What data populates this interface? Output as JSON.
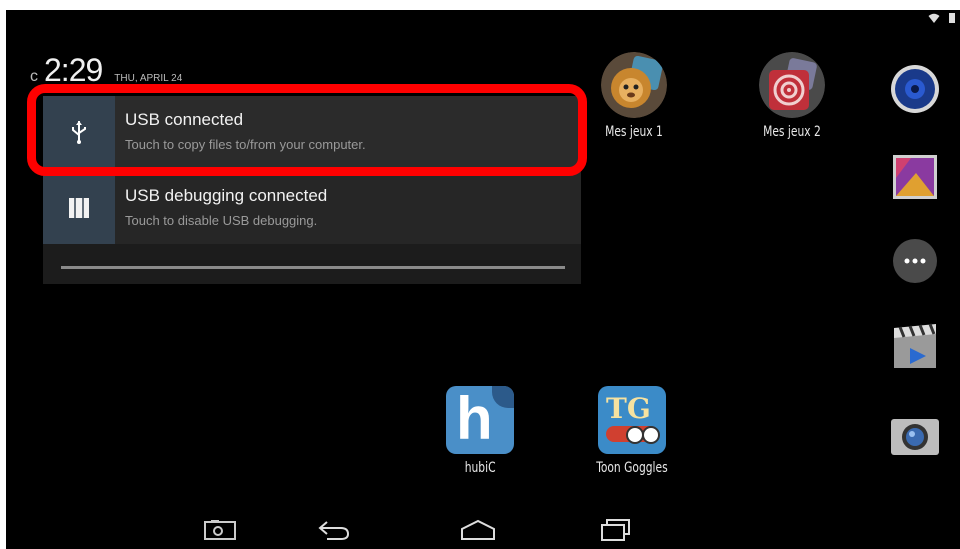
{
  "clock": {
    "prefix": "c",
    "time": "2:29",
    "date": "THU, APRIL 24"
  },
  "notifications": [
    {
      "title": "USB connected",
      "subtitle": "Touch to copy files to/from your computer.",
      "icon": "usb-icon"
    },
    {
      "title": "USB debugging connected",
      "subtitle": "Touch to disable USB debugging.",
      "icon": "debug-icon"
    }
  ],
  "apps": {
    "mes_jeux_1": "Mes jeux 1",
    "mes_jeux_2": "Mes jeux 2",
    "hubic": "hubiC",
    "toon_goggles": "Toon Goggles",
    "hubic_letter": "h",
    "toon_letters": "TG"
  },
  "dock": [
    "music-icon",
    "gallery-icon",
    "all-apps-icon",
    "movie-studio-icon",
    "camera-icon"
  ],
  "navbar": [
    "screenshot-icon",
    "back-icon",
    "home-icon",
    "recents-icon"
  ],
  "colors": {
    "highlight": "#ff0000",
    "notif_icon_bg": "#33414f",
    "background": "#000000"
  }
}
